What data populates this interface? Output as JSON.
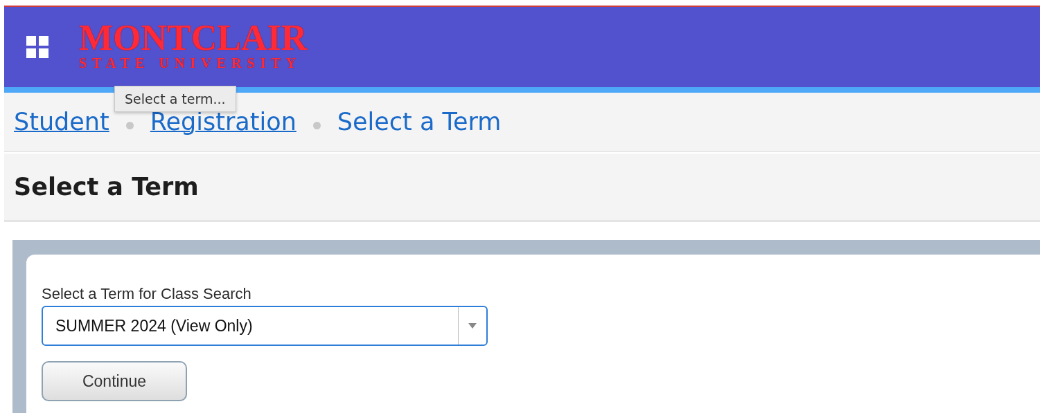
{
  "header": {
    "logo_title": "MONTCLAIR",
    "logo_subtitle": "STATE UNIVERSITY"
  },
  "tooltip": {
    "text": "Select a term..."
  },
  "breadcrumbs": [
    {
      "label": "Student",
      "kind": "link"
    },
    {
      "label": "Registration",
      "kind": "link"
    },
    {
      "label": "Select a Term",
      "kind": "current"
    }
  ],
  "page_title": "Select a Term",
  "form": {
    "label": "Select a Term for Class Search",
    "select": {
      "value": "SUMMER 2024 (View Only)"
    },
    "button": "Continue"
  }
}
